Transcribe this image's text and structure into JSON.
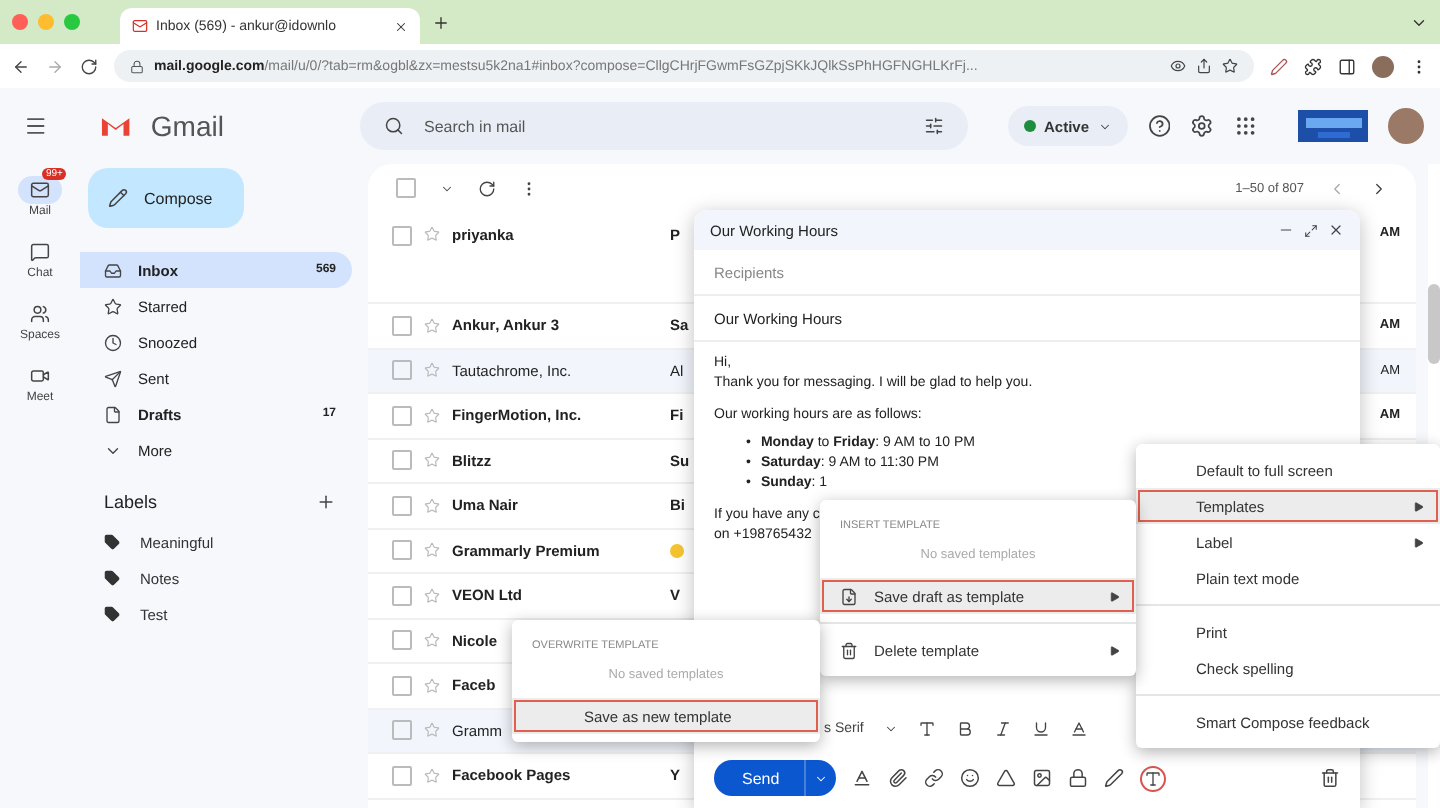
{
  "browser": {
    "tab_title": "Inbox (569) - ankur@idownlo",
    "url_host": "mail.google.com",
    "url_path": "/mail/u/0/?tab=rm&ogbl&zx=mestsu5k2na1#inbox?compose=CllgCHrjFGwmFsGZpjSKkJQlkSsPhHGFNGHLKrFj..."
  },
  "header": {
    "logo": "Gmail",
    "search": {
      "placeholder": "Search in mail"
    },
    "status": "Active"
  },
  "rail": [
    {
      "kind": "mail",
      "label": "Mail",
      "badge": "99+",
      "selected": true
    },
    {
      "kind": "chat",
      "label": "Chat",
      "selected": false
    },
    {
      "kind": "spaces",
      "label": "Spaces",
      "selected": false
    },
    {
      "kind": "meet",
      "label": "Meet",
      "selected": false
    }
  ],
  "sidebar": {
    "compose": "Compose",
    "items": [
      {
        "kind": "inbox",
        "label": "Inbox",
        "count": "569",
        "selected": true,
        "unread": true
      },
      {
        "kind": "starred",
        "label": "Starred",
        "selected": false,
        "unread": false
      },
      {
        "kind": "snoozed",
        "label": "Snoozed",
        "selected": false,
        "unread": false
      },
      {
        "kind": "sent",
        "label": "Sent",
        "selected": false,
        "unread": false
      },
      {
        "kind": "drafts",
        "label": "Drafts",
        "count": "17",
        "selected": false,
        "unread": true
      },
      {
        "kind": "more",
        "label": "More",
        "selected": false,
        "unread": false
      }
    ],
    "labels_title": "Labels",
    "labels": [
      "Meaningful",
      "Notes",
      "Test"
    ]
  },
  "list": {
    "select_all": {
      "checked": false
    },
    "range": "1–50 of 807",
    "rows": [
      {
        "sender": "priyanka",
        "unread": true,
        "snippet": "P",
        "time": "AM"
      },
      {
        "sender": "**Ankur**, Ankur 3",
        "unread": true,
        "snippet": "Sa",
        "time": "AM"
      },
      {
        "sender": "Tautachrome, Inc.",
        "unread": false,
        "snippet": "Al",
        "time": "AM"
      },
      {
        "sender": "FingerMotion, Inc.",
        "unread": true,
        "snippet": "Fi",
        "time": "AM"
      },
      {
        "sender": "Blitzz",
        "unread": true,
        "snippet": "Su"
      },
      {
        "sender": "Uma Nair",
        "unread": true,
        "snippet": "Bi"
      },
      {
        "sender": "Grammarly Premium",
        "unread": true,
        "emoji": true
      },
      {
        "sender": "VEON Ltd",
        "unread": true,
        "snippet": "V"
      },
      {
        "sender": "Nicole",
        "unread": true
      },
      {
        "sender": "Faceb",
        "unread": true
      },
      {
        "sender": "Gramm",
        "unread": false
      },
      {
        "sender": "Facebook Pages",
        "unread": true,
        "snippet": "Y"
      }
    ]
  },
  "compose": {
    "title": "Our Working Hours",
    "recipients": {
      "placeholder": "Recipients"
    },
    "subject": "Our Working Hours",
    "greeting": [
      "Hi,",
      "Thank you for messaging. I will be glad to help you."
    ],
    "intro": "Our working hours are as follows:",
    "marker": "•",
    "bullets": [
      "**Monday** to **Friday**: 9 AM to 10 PM",
      "**Saturday**: 9 AM to 11:30 PM",
      "**Sunday**: 1"
    ],
    "footer_lines": [
      "If you have any c",
      "on +198765432"
    ],
    "font": "s Serif",
    "send": "Send"
  },
  "more_menu": [
    {
      "kind": "item",
      "label": "Default to full screen",
      "selected": false
    },
    {
      "kind": "submenu",
      "label": "Templates",
      "selected": true
    },
    {
      "kind": "submenu",
      "label": "Label",
      "selected": false
    },
    {
      "kind": "item",
      "label": "Plain text mode",
      "selected": false
    },
    {
      "kind": "divider"
    },
    {
      "kind": "item",
      "label": "Print",
      "selected": false
    },
    {
      "kind": "item",
      "label": "Check spelling",
      "selected": false
    },
    {
      "kind": "divider"
    },
    {
      "kind": "item",
      "label": "Smart Compose feedback",
      "selected": false
    }
  ],
  "templates_menu": [
    {
      "kind": "header",
      "label": "INSERT TEMPLATE"
    },
    {
      "kind": "empty",
      "label": "No saved templates"
    },
    {
      "kind": "save",
      "label": "Save draft as template",
      "selected": true
    },
    {
      "kind": "divider"
    },
    {
      "kind": "delete",
      "label": "Delete template",
      "selected": false
    }
  ],
  "overwrite_menu": [
    {
      "kind": "header",
      "label": "OVERWRITE TEMPLATE"
    },
    {
      "kind": "empty",
      "label": "No saved templates"
    },
    {
      "kind": "item",
      "label": "Save as new template",
      "selected": true
    }
  ]
}
